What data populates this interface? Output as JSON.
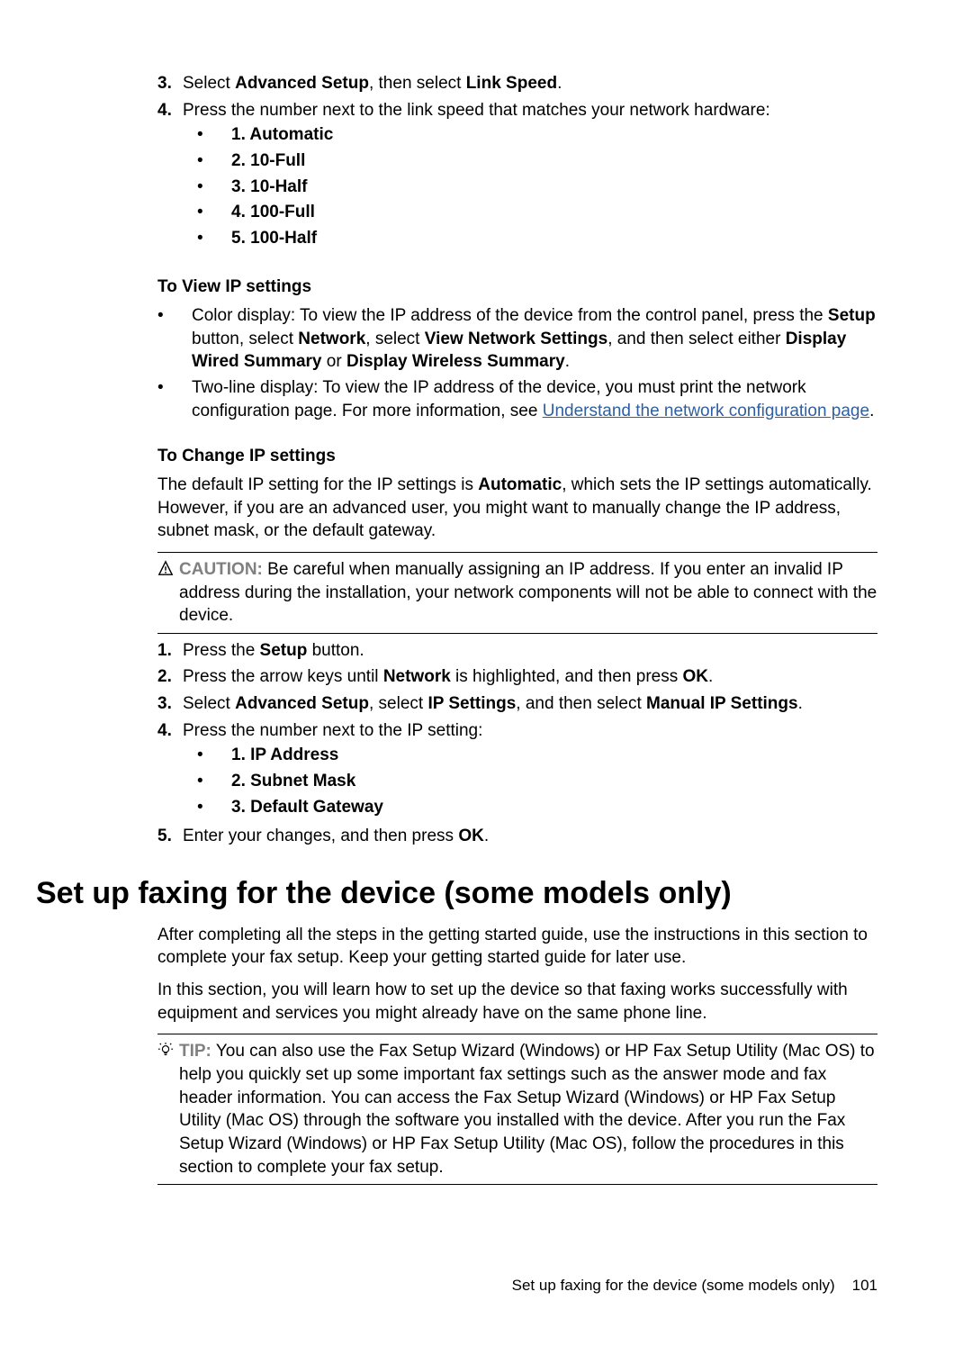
{
  "top_list": {
    "n3": "3.",
    "t3_a": "Select ",
    "t3_b": "Advanced Setup",
    "t3_c": ", then select ",
    "t3_d": "Link Speed",
    "t3_e": ".",
    "n4": "4.",
    "t4": "Press the number next to the link speed that matches your network hardware:",
    "opts": [
      "1. Automatic",
      "2. 10-Full",
      "3. 10-Half",
      "4. 100-Full",
      "5. 100-Half"
    ]
  },
  "view_ip": {
    "heading": "To View IP settings",
    "b1_a": "Color display: To view the IP address of the device from the control panel, press the ",
    "b1_b": "Setup",
    "b1_c": " button, select ",
    "b1_d": "Network",
    "b1_e": ", select ",
    "b1_f": "View Network Settings",
    "b1_g": ", and then select either ",
    "b1_h": "Display Wired Summary",
    "b1_i": " or ",
    "b1_j": "Display Wireless Summary",
    "b1_k": ".",
    "b2_a": "Two-line display: To view the IP address of the device, you must print the network configuration page. For more information, see ",
    "b2_link": "Understand the network configuration page",
    "b2_b": "."
  },
  "change_ip": {
    "heading": "To Change IP settings",
    "para_a": "The default IP setting for the IP settings is ",
    "para_b": "Automatic",
    "para_c": ", which sets the IP settings automatically. However, if you are an advanced user, you might want to manually change the IP address, subnet mask, or the default gateway.",
    "caution_label": "CAUTION:",
    "caution_text": "  Be careful when manually assigning an IP address. If you enter an invalid IP address during the installation, your network components will not be able to connect with the device.",
    "steps": {
      "n1": "1.",
      "t1_a": "Press the ",
      "t1_b": "Setup",
      "t1_c": " button.",
      "n2": "2.",
      "t2_a": "Press the arrow keys until ",
      "t2_b": "Network",
      "t2_c": " is highlighted, and then press ",
      "t2_d": "OK",
      "t2_e": ".",
      "n3": "3.",
      "t3_a": "Select ",
      "t3_b": "Advanced Setup",
      "t3_c": ", select ",
      "t3_d": "IP Settings",
      "t3_e": ", and then select ",
      "t3_f": "Manual IP Settings",
      "t3_g": ".",
      "n4": "4.",
      "t4": "Press the number next to the IP setting:",
      "opts": [
        "1. IP Address",
        "2. Subnet Mask",
        "3. Default Gateway"
      ],
      "n5": "5.",
      "t5_a": "Enter your changes, and then press ",
      "t5_b": "OK",
      "t5_c": "."
    }
  },
  "fax": {
    "h1": "Set up faxing for the device (some models only)",
    "p1": "After completing all the steps in the getting started guide, use the instructions in this section to complete your fax setup. Keep your getting started guide for later use.",
    "p2": "In this section, you will learn how to set up the device so that faxing works successfully with equipment and services you might already have on the same phone line.",
    "tip_label": "TIP:",
    "tip_text": "  You can also use the Fax Setup Wizard (Windows) or HP Fax Setup Utility (Mac OS) to help you quickly set up some important fax settings such as the answer mode and fax header information. You can access the Fax Setup Wizard (Windows) or HP Fax Setup Utility (Mac OS) through the software you installed with the device. After you run the Fax Setup Wizard (Windows) or HP Fax Setup Utility (Mac OS), follow the procedures in this section to complete your fax setup."
  },
  "footer": {
    "label": "Set up faxing for the device (some models only)",
    "page": "101"
  }
}
